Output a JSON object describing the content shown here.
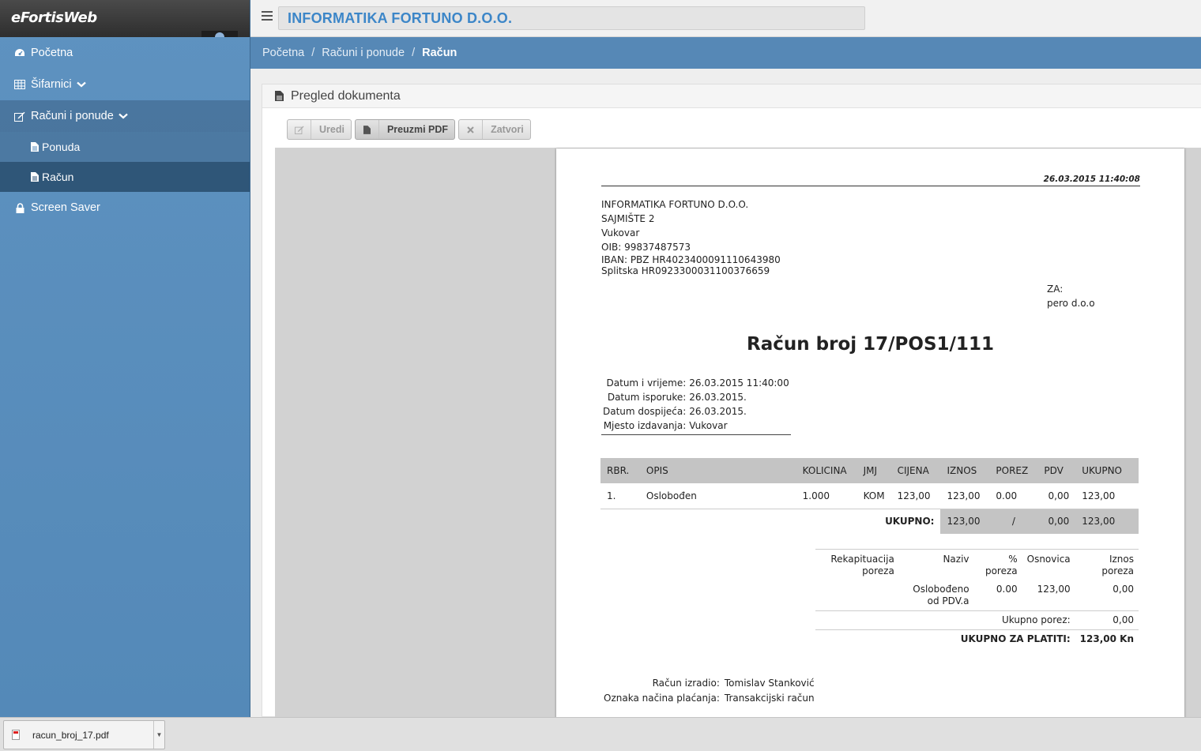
{
  "app": {
    "logo": "eFortisWeb",
    "company": "INFORMATIKA FORTUNO D.O.O."
  },
  "sidebar": {
    "items": [
      {
        "label": "Početna",
        "icon": "dashboard-icon"
      },
      {
        "label": "Šifarnici",
        "icon": "table-icon"
      },
      {
        "label": "Računi i ponude",
        "icon": "edit-icon"
      },
      {
        "label": "Ponuda",
        "icon": "file-icon"
      },
      {
        "label": "Račun",
        "icon": "file-icon"
      },
      {
        "label": "Screen Saver",
        "icon": "lock-icon"
      }
    ]
  },
  "breadcrumb": {
    "home": "Početna",
    "section": "Računi i ponude",
    "current": "Račun"
  },
  "panel": {
    "title": "Pregled dokumenta"
  },
  "toolbar": {
    "edit_label": "Uredi",
    "pdf_label": "Preuzmi PDF",
    "close_label": "Zatvori"
  },
  "document": {
    "timestamp": "26.03.2015 11:40:08",
    "issuer": {
      "name": "INFORMATIKA FORTUNO D.O.O.",
      "address": "SAJMIŠTE 2",
      "city": "Vukovar",
      "oib": "OIB: 99837487573",
      "iban1": "IBAN: PBZ HR4023400091110643980",
      "iban2": "Splitska HR0923300031100376659"
    },
    "recipient": {
      "label": "ZA:",
      "name": "pero d.o.o"
    },
    "title": "Račun broj 17/POS1/111",
    "meta": {
      "datetime_label": "Datum i vrijeme:",
      "datetime": "26.03.2015 11:40:00",
      "delivery_label": "Datum isporuke:",
      "delivery": "26.03.2015.",
      "due_label": "Datum dospijeća:",
      "due": "26.03.2015.",
      "place_label": "Mjesto izdavanja:",
      "place": "Vukovar"
    },
    "items_headers": [
      "RBR.",
      "OPIS",
      "KOLICINA",
      "JMJ",
      "CIJENA",
      "IZNOS",
      "POREZ",
      "PDV",
      "UKUPNO"
    ],
    "items": [
      {
        "rbr": "1.",
        "opis": "Oslobođen",
        "kolicina": "1.000",
        "jmj": "KOM",
        "cijena": "123,00",
        "iznos": "123,00",
        "porez": "0.00",
        "pdv": "0,00",
        "ukupno": "123,00"
      }
    ],
    "totals": {
      "label": "UKUPNO:",
      "iznos": "123,00",
      "porez": "/",
      "pdv": "0,00",
      "ukupno": "123,00"
    },
    "recap": {
      "h_recap": "Rekapituacija poreza",
      "h_name": "Naziv",
      "h_pct": "% poreza",
      "h_base": "Osnovica",
      "h_amount": "Iznos poreza",
      "row_name": "Oslobođeno od PDV.a",
      "row_pct": "0.00",
      "row_base": "123,00",
      "row_amount": "0,00",
      "total_tax_label": "Ukupno porez:",
      "total_tax": "0,00",
      "grand_label": "UKUPNO ZA PLATITI:",
      "grand": "123,00 Kn"
    },
    "footer": {
      "author_label": "Račun izradio:",
      "author": "Tomislav Stanković",
      "payment_label": "Oznaka načina plaćanja:",
      "payment": "Transakcijski račun"
    }
  },
  "download": {
    "filename": "racun_broj_17.pdf"
  }
}
